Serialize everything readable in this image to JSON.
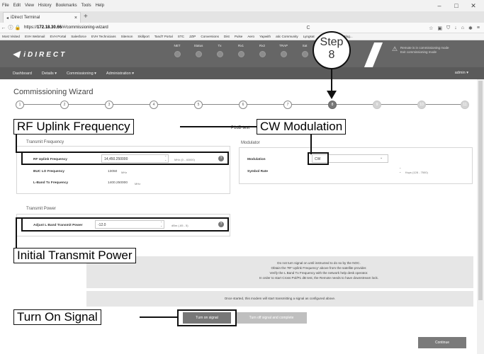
{
  "browser": {
    "menu": [
      "File",
      "Edit",
      "View",
      "History",
      "Bookmarks",
      "Tools",
      "Help"
    ],
    "tab_title": "iDirect Terminal",
    "url_prefix": "https://",
    "url_host": "172.18.30.66",
    "url_path": "/#/commissioning-wizard",
    "bookmarks": [
      "Most Visited",
      "EVH Webmail",
      "EVH Portal",
      "Salesforce",
      "EVH Technicians",
      "Sitemon",
      "Skillport",
      "TandT Portal",
      "STC",
      "JZIP",
      "Conversions",
      "Dist",
      "Pulse",
      "Aero",
      "Yapwith",
      "atic Community",
      "Lyngsat",
      "CI Improvement Blog..."
    ]
  },
  "header": {
    "logo_text": "iDIRECT",
    "status_items": [
      "NET",
      "Status",
      "Tx",
      "Rx1",
      "Rx2",
      "TRAP",
      "Sat"
    ],
    "alert_text_1": "Remote is in commissioning mode",
    "alert_text_2": "Exit commissioning mode"
  },
  "nav": {
    "items": [
      "Dashboard",
      "Details ▾",
      "Commissioning ▾",
      "Administration ▾"
    ],
    "user": "admin ▾"
  },
  "wizard": {
    "title": "Commissioning Wizard",
    "steps": [
      "1",
      "2",
      "3",
      "4",
      "5",
      "6",
      "7",
      "8",
      "9",
      "10",
      "11"
    ],
    "current_step_label": "8",
    "section_header": "P1dB test"
  },
  "transmit_frequency": {
    "title": "Transmit Frequency",
    "rf_uplink_label": "RF Uplink Frequency",
    "rf_uplink_value": "14,450.250000",
    "rf_uplink_unit": "MHz (0 - 40000)",
    "buc_lo_label": "BUC LO Frequency",
    "buc_lo_value": "13050",
    "buc_lo_unit": "MHz",
    "lband_label": "L-Band Tx Frequency",
    "lband_value": "1400.250000",
    "lband_unit": "MHz"
  },
  "modulator": {
    "title": "Modulator",
    "modulation_label": "Modulation",
    "modulation_value": "CW",
    "symbol_rate_label": "Symbol Rate",
    "symbol_rate_unit": "Ksps (128 - 7500)"
  },
  "transmit_power": {
    "title": "Transmit Power",
    "adjust_label": "Adjust L Band Transmit Power",
    "adjust_value": "-12.0",
    "adjust_unit": "dBm (-65 - 5)"
  },
  "messages": {
    "line1": "Do not turn signal on until instructed to do so by the NOC.",
    "line2": "Obtain the 'RF Uplink Frequency' above from the satellite provider.",
    "line3": "Verify the L Band Tx Frequency with the network help desk operator.",
    "line4": "In order to start Cross Pol/P1 dB test, the Remote needs to have downstream lock.",
    "info": "Once started, this modem will start transmitting a signal as configured above."
  },
  "buttons": {
    "turn_on": "Turn on signal",
    "turn_off": "Turn off signal and complete",
    "continue": "Continue"
  },
  "callouts": {
    "step_line1": "Step",
    "step_line2": "8",
    "rf_uplink": "RF Uplink Frequency",
    "cw_modulation": "CW Modulation",
    "initial_power": "Initial Transmit Power",
    "turn_on_signal": "Turn On Signal"
  }
}
